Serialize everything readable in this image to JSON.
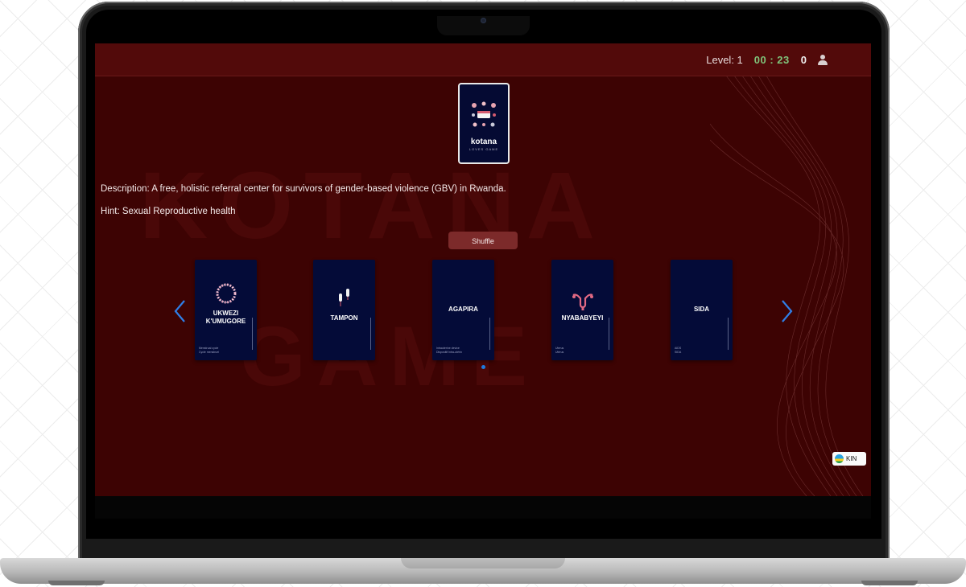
{
  "hud": {
    "level": "Level: 1",
    "timer": "00 : 23",
    "score": "0"
  },
  "watermark": {
    "line1": "KOTANA",
    "line2": "GAME"
  },
  "hero_card": {
    "title": "kotana",
    "subtitle": "LOVES GAME"
  },
  "prompt": {
    "description": "Description: A free, holistic referral center for survivors of gender-based violence (GBV) in Rwanda.",
    "hint": "Hint: Sexual Reproductive health"
  },
  "shuffle_label": "Shuffle",
  "cards": [
    {
      "title_line1": "UKWEZI",
      "title_line2": "K'UMUGORE",
      "foot_line1": "Menstrual cycle",
      "foot_line2": "Cycle menstruel",
      "icon": "cycle-ring-icon"
    },
    {
      "title_line1": "TAMPON",
      "title_line2": "",
      "foot_line1": "",
      "foot_line2": "",
      "icon": "tampon-icon"
    },
    {
      "title_line1": "AGAPIRA",
      "title_line2": "",
      "foot_line1": "Intrauterine device",
      "foot_line2": "Dispositif intra-utérin",
      "icon": ""
    },
    {
      "title_line1": "NYABABYEYI",
      "title_line2": "",
      "foot_line1": "Uterus",
      "foot_line2": "Utérus",
      "icon": "uterus-icon"
    },
    {
      "title_line1": "SIDA",
      "title_line2": "",
      "foot_line1": "AIDS",
      "foot_line2": "SIDA",
      "icon": ""
    }
  ],
  "language": {
    "label": "KIN"
  },
  "colors": {
    "background": "#3d0303",
    "topbar": "#520a0a",
    "card": "#040b38",
    "timer": "#7fc47b",
    "accent": "#1e7be0"
  }
}
